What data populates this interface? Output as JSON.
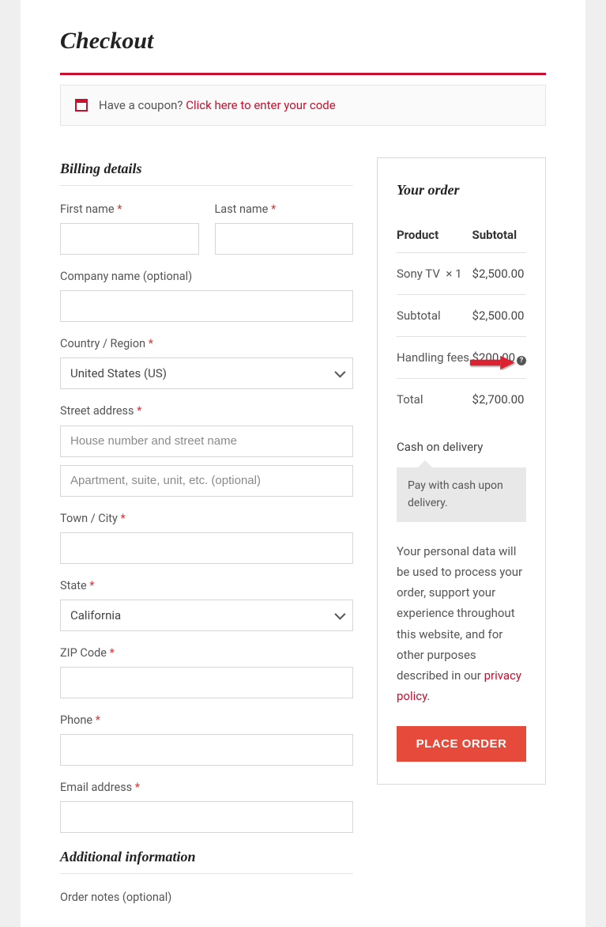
{
  "page_title": "Checkout",
  "coupon": {
    "prompt": "Have a coupon?",
    "link": "Click here to enter your code"
  },
  "billing": {
    "heading": "Billing details",
    "first_name_label": "First name",
    "last_name_label": "Last name",
    "company_label": "Company name (optional)",
    "country_label": "Country / Region",
    "country_value": "United States (US)",
    "street_label": "Street address",
    "street1_placeholder": "House number and street name",
    "street2_placeholder": "Apartment, suite, unit, etc. (optional)",
    "city_label": "Town / City",
    "state_label": "State",
    "state_value": "California",
    "zip_label": "ZIP Code",
    "phone_label": "Phone",
    "email_label": "Email address"
  },
  "additional": {
    "heading": "Additional information",
    "notes_label": "Order notes (optional)"
  },
  "order": {
    "heading": "Your order",
    "col_product": "Product",
    "col_subtotal": "Subtotal",
    "items": [
      {
        "name": "Sony TV",
        "qty": "× 1",
        "price": "$2,500.00"
      }
    ],
    "subtotal_label": "Subtotal",
    "subtotal_value": "$2,500.00",
    "handling_label": "Handling fees",
    "handling_value": "$200.00",
    "total_label": "Total",
    "total_value": "$2,700.00"
  },
  "payment": {
    "method": "Cash on delivery",
    "description": "Pay with cash upon delivery."
  },
  "privacy": {
    "text_before": "Your personal data will be used to process your order, support your experience throughout this website, and for other purposes described in our ",
    "link": "privacy policy",
    "text_after": "."
  },
  "place_order_label": "PLACE ORDER"
}
